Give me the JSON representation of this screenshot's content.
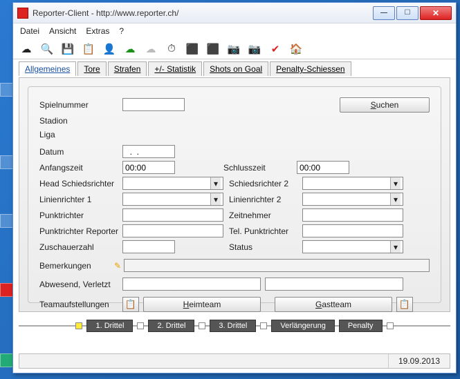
{
  "window": {
    "title": "Reporter-Client  -  http://www.reporter.ch/"
  },
  "menu": {
    "datei": "Datei",
    "ansicht": "Ansicht",
    "extras": "Extras",
    "help": "?"
  },
  "tabs": {
    "allgemeines": "Allgemeines",
    "tore": "Tore",
    "strafen": "Strafen",
    "statistik": "+/- Statistik",
    "shotsongoal": "Shots on Goal",
    "penaltyschiessen": "Penalty-Schiessen"
  },
  "form": {
    "spielnummer_label": "Spielnummer",
    "spielnummer_value": "",
    "suchen": "Suchen",
    "stadion_label": "Stadion",
    "liga_label": "Liga",
    "datum_label": "Datum",
    "datum_value": "  .  .",
    "anfangszeit_label": "Anfangszeit",
    "anfangszeit_value": "00:00",
    "schlusszeit_label": "Schlusszeit",
    "schlusszeit_value": "00:00",
    "head_sr_label": "Head Schiedsrichter",
    "sr2_label": "Schiedsrichter 2",
    "lr1_label": "Linienrichter 1",
    "lr2_label": "Linienrichter 2",
    "punktrichter_label": "Punktrichter",
    "zeitnehmer_label": "Zeitnehmer",
    "punktrichter_rep_label": "Punktrichter Reporter",
    "tel_punktrichter_label": "Tel. Punktrichter",
    "zuschauer_label": "Zuschauerzahl",
    "status_label": "Status",
    "bemerkungen_label": "Bemerkungen",
    "abwesend_label": "Abwesend, Verletzt",
    "teamaufstellungen_label": "Teamaufstellungen",
    "heimteam": "Heimteam",
    "gastteam": "Gastteam"
  },
  "periods": {
    "p1": "1. Drittel",
    "p2": "2. Drittel",
    "p3": "3. Drittel",
    "verl": "Verlängerung",
    "pen": "Penalty"
  },
  "status": {
    "date": "19.09.2013"
  }
}
